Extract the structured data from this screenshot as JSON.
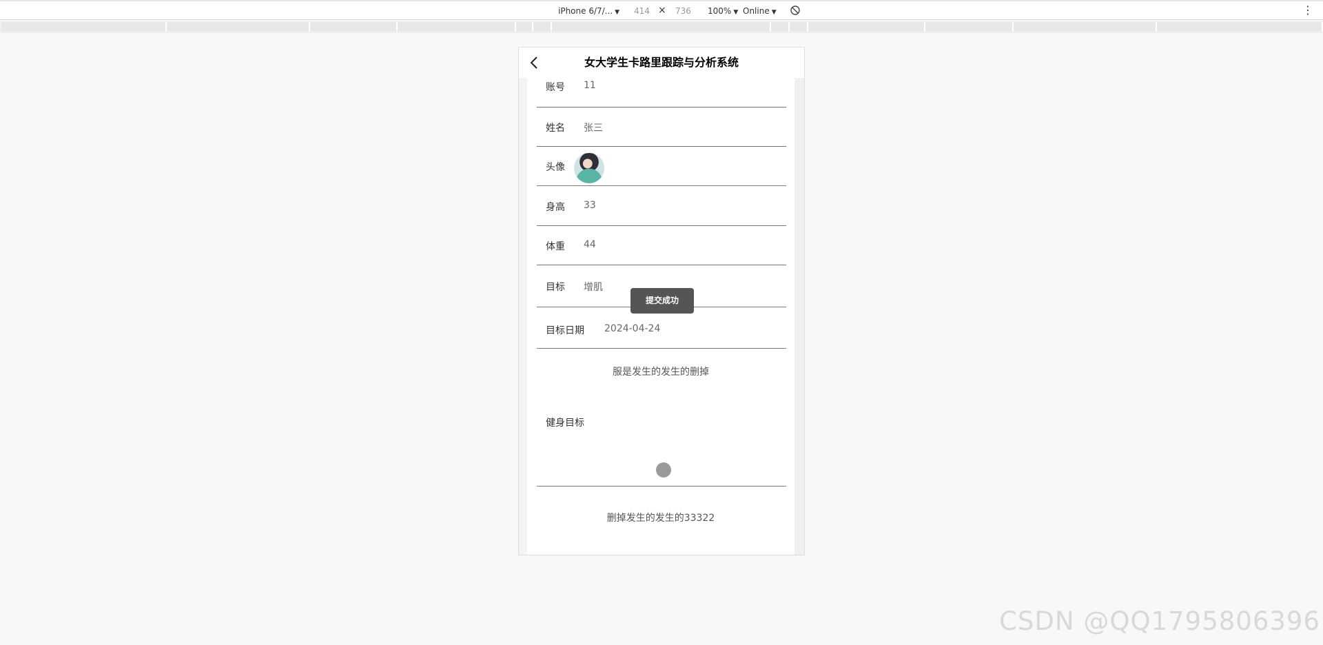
{
  "devtools": {
    "device": "iPhone 6/7/...",
    "width": "414",
    "times": "×",
    "height": "736",
    "zoom": "100%",
    "network": "Online"
  },
  "header": {
    "title": "女大学生卡路里跟踪与分析系统"
  },
  "fields": [
    {
      "label": "账号",
      "value": "11"
    },
    {
      "label": "姓名",
      "value": "张三"
    },
    {
      "label": "头像",
      "value": ""
    },
    {
      "label": "身高",
      "value": "33"
    },
    {
      "label": "体重",
      "value": "44"
    },
    {
      "label": "目标",
      "value": "增肌"
    },
    {
      "label": "目标日期",
      "value": "2024-04-24"
    }
  ],
  "note_1": "服是发生的发生的删掉",
  "fitness_goal_label": "健身目标",
  "note_2": "删掉发生的发生的33322",
  "toast": "提交成功",
  "watermark": "CSDN @QQ1795806396"
}
